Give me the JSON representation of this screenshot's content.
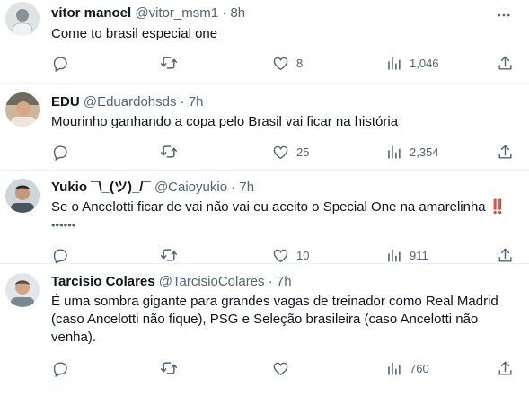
{
  "tweets": [
    {
      "name": "vitor manoel",
      "handle": "@vitor_msm1",
      "dot": "·",
      "time": "8h",
      "text": "Come to brasil especial one",
      "likes": "8",
      "views": "1,046"
    },
    {
      "name": "EDU",
      "handle": "@Eduardohsds",
      "dot": "·",
      "time": "7h",
      "text": "Mourinho ganhando a copa pelo Brasil vai ficar na história",
      "likes": "25",
      "views": "2,354"
    },
    {
      "name": "Yukio ¯\\_(ツ)_/¯",
      "handle": "@Caioyukio",
      "dot": "·",
      "time": "7h",
      "text": "Se o Ancelotti ficar de vai não vai eu aceito o Special One na amarelinha",
      "text_emoji": "‼️",
      "line2": "••••••",
      "likes": "10",
      "views": "911"
    },
    {
      "name": "Tarcisio Colares",
      "handle": "@TarcisioColares",
      "dot": "·",
      "time": "7h",
      "text": "É uma sombra gigante para grandes vagas de treinador como Real Madrid (caso Ancelotti não fique), PSG e Seleção brasileira (caso Ancelotti não venha).",
      "likes": "",
      "views": "760"
    }
  ],
  "icons": {
    "reply": "reply-icon",
    "retweet": "retweet-icon",
    "like": "heart-icon",
    "views": "views-icon",
    "share": "share-icon",
    "more": "more-icon"
  },
  "colors": {
    "text": "#0f1419",
    "secondary": "#536471",
    "divider": "#eff3f4"
  }
}
